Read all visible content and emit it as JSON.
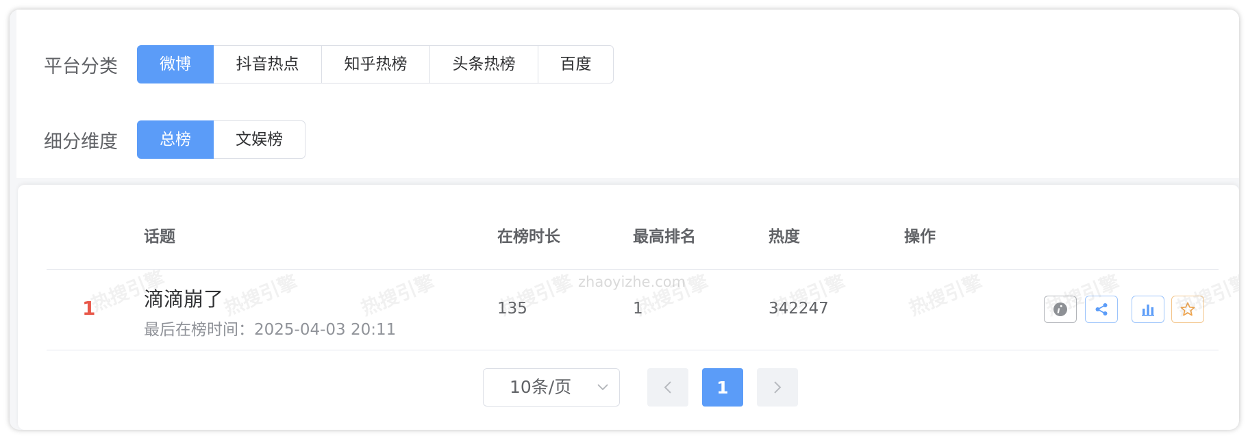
{
  "filters": {
    "platform_label": "平台分类",
    "platform_options": [
      "微博",
      "抖音热点",
      "知乎热榜",
      "头条热榜",
      "百度"
    ],
    "dimension_label": "细分维度",
    "dimension_options": [
      "总榜",
      "文娱榜"
    ]
  },
  "table": {
    "headers": {
      "topic": "话题",
      "duration": "在榜时长",
      "best_rank": "最高排名",
      "heat": "热度",
      "actions": "操作"
    },
    "rows": [
      {
        "rank": "1",
        "title": "滴滴崩了",
        "last_seen": "最后在榜时间：2025-04-03 20:11",
        "duration": "135",
        "best_rank": "1",
        "heat": "342247"
      }
    ]
  },
  "pagination": {
    "page_size": "10条/页",
    "current_page": "1"
  },
  "watermark": {
    "text": "热搜引擎",
    "url": "zhaoyizhe.com"
  },
  "colors": {
    "accent": "#5b9cf8",
    "rank_red": "#e8584a",
    "star_orange": "#f0a34a"
  }
}
